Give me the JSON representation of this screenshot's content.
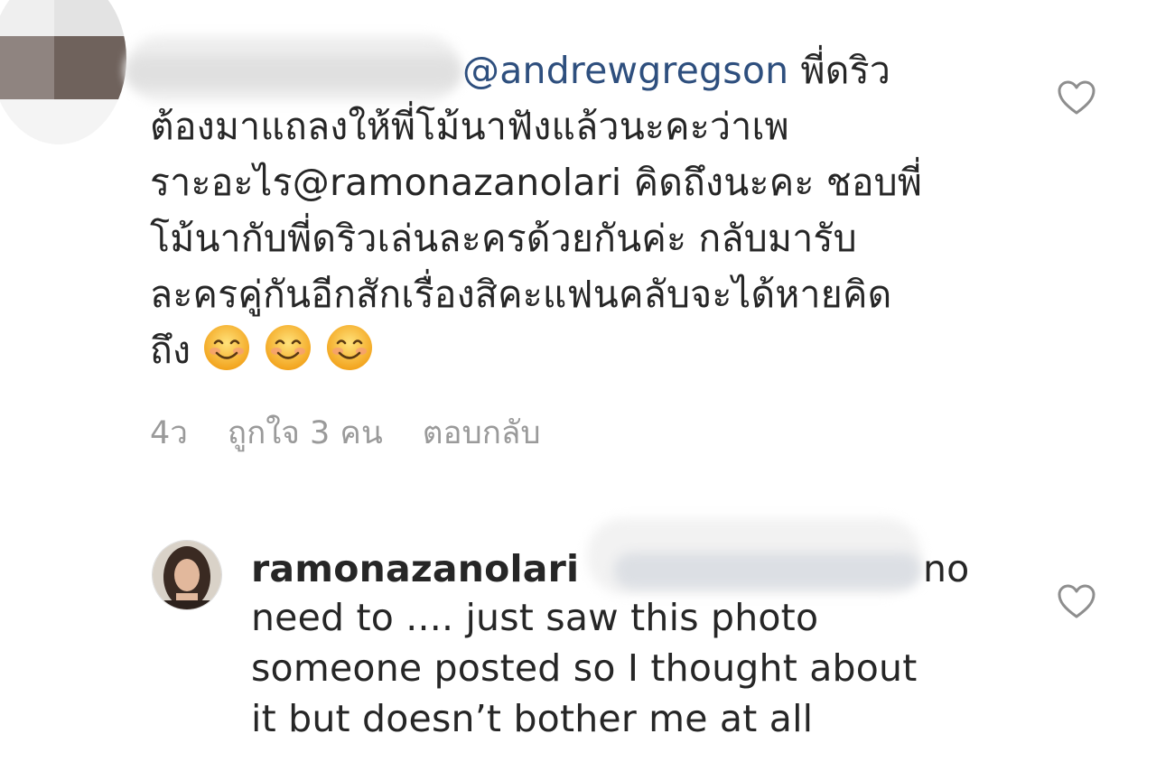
{
  "comment1": {
    "mention": "@andrewgregson",
    "line1_rest": " พี่ดริว",
    "line2": "ต้องมาแถลงให้พี่โม้นาฟังแล้วนะคะว่าเพ",
    "line3": "ราะอะไร@ramonazanolari คิดถึงนะคะ ชอบพี่",
    "line4": "โม้นากับพี่ดริวเล่นละครด้วยกันค่ะ กลับมารับ",
    "line5": "ละครคู่กันอีกสักเรื่องสิคะแฟนคลับจะได้หายคิด",
    "line6": "ถึง",
    "emoji_count": 3,
    "time": "4ว",
    "likes": "ถูกใจ 3 คน",
    "reply": "ตอบกลับ"
  },
  "comment2": {
    "username": "ramonazanolari",
    "line1_end": "no",
    "line2": "need to .... just saw this photo",
    "line3": "someone posted so I thought about",
    "line4": "it but doesn’t bother me at all"
  },
  "icons": {
    "like": "heart-outline-icon",
    "emoji": "smiling-face-emoji"
  },
  "colors": {
    "mention": "#2e4f7e",
    "meta": "#9a9a9a",
    "text": "#262626"
  }
}
